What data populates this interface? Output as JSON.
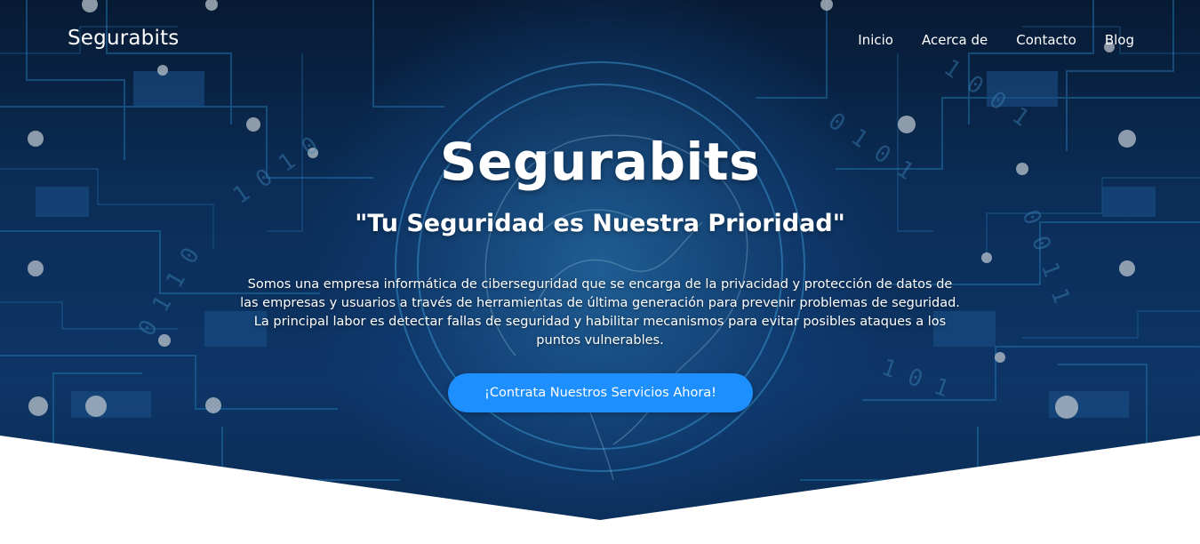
{
  "header": {
    "brand": "Segurabits",
    "nav": [
      {
        "label": "Inicio"
      },
      {
        "label": "Acerca de"
      },
      {
        "label": "Contacto"
      },
      {
        "label": "Blog"
      }
    ]
  },
  "hero": {
    "title": "Segurabits",
    "tagline": "\"Tu Seguridad es Nuestra Prioridad\"",
    "description": "Somos una empresa informática de ciberseguridad que se encarga de la privacidad y protección de datos de las empresas y usuarios a través de herramientas de última generación para prevenir problemas de seguridad. La principal labor es detectar fallas de seguridad y habilitar mecanismos para evitar posibles ataques a los puntos vulnerables.",
    "cta_label": "¡Contrata Nuestros Servicios Ahora!"
  },
  "colors": {
    "hero_bg": "#0b2d57",
    "cta_bg": "#1e8fff",
    "text": "#ffffff"
  }
}
